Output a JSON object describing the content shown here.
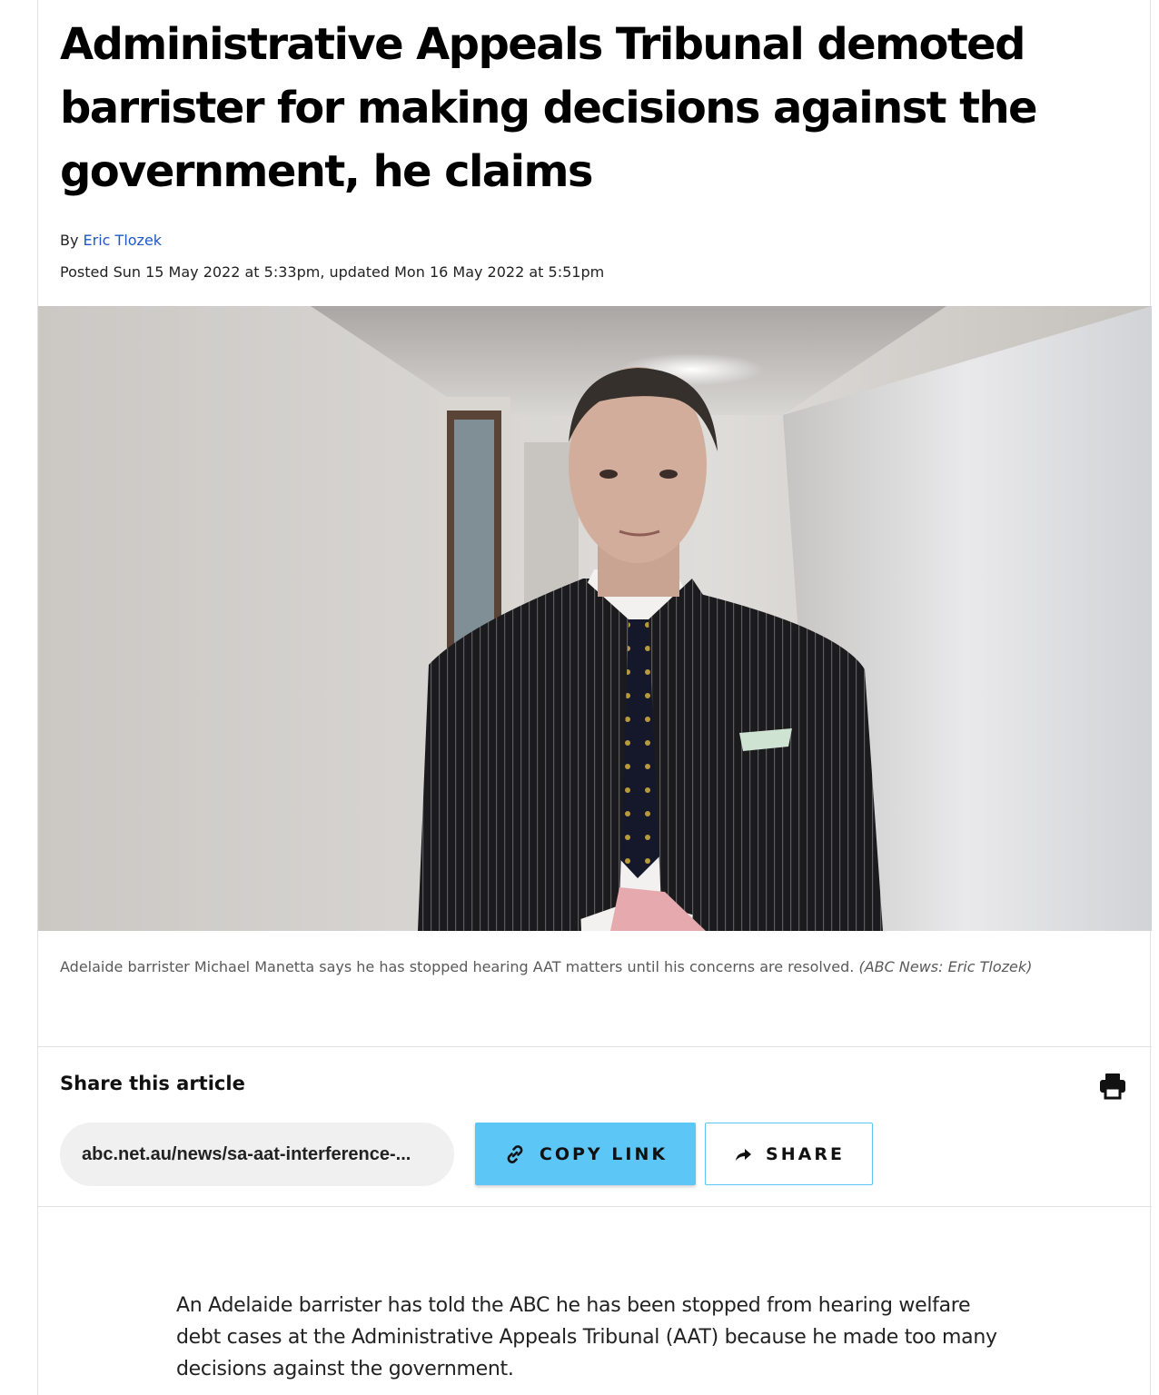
{
  "article": {
    "headline": "Administrative Appeals Tribunal demoted barrister for making decisions against the government, he claims",
    "byline_prefix": "By ",
    "author": "Eric Tlozek",
    "dateline": "Posted Sun 15 May 2022 at 5:33pm, updated Mon 16 May 2022 at 5:51pm",
    "caption_text": "Adelaide barrister Michael Manetta says he has stopped hearing AAT matters until his concerns are resolved. ",
    "caption_credit": "(ABC News: Eric Tlozek)",
    "body_first_paragraph": "An Adelaide barrister has told the ABC he has been stopped from hearing welfare debt cases at the Administrative Appeals Tribunal (AAT) because he made too many decisions against the government."
  },
  "share": {
    "title": "Share this article",
    "url": "abc.net.au/news/sa-aat-interference-...",
    "copy_label": "COPY LINK",
    "share_label": "SHARE",
    "print_icon": "print-icon",
    "link_icon": "link-icon",
    "share_icon": "share-arrow-icon",
    "accent_color": "#5cc6f6"
  },
  "colors": {
    "author_link": "#1f58c9",
    "headline": "#000000"
  }
}
